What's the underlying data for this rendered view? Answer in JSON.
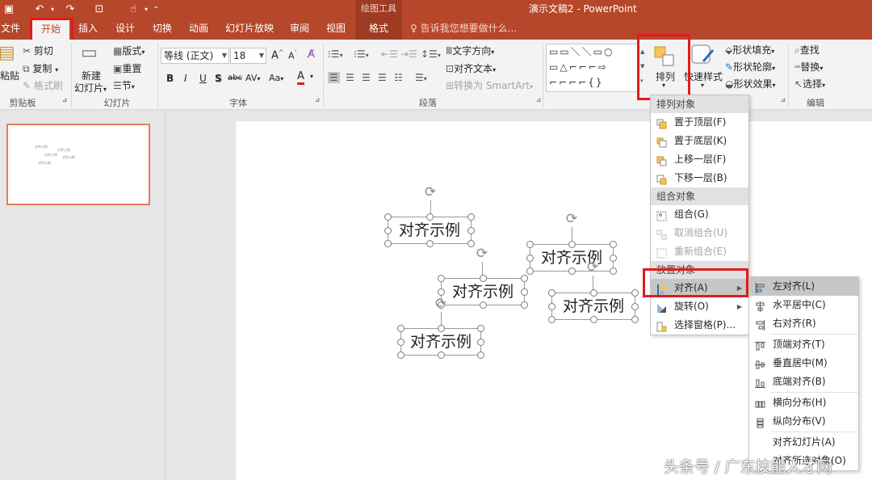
{
  "titlebar": {
    "context_title": "绘图工具",
    "doc_title": "演示文稿2 - PowerPoint"
  },
  "tabs": {
    "file": "文件",
    "home": "开始",
    "insert": "插入",
    "design": "设计",
    "transitions": "切换",
    "animations": "动画",
    "slideshow": "幻灯片放映",
    "review": "审阅",
    "view": "视图",
    "format": "格式",
    "tellme": "告诉我您想要做什么..."
  },
  "ribbon": {
    "clipboard": {
      "paste": "粘贴",
      "cut": "剪切",
      "copy": "复制",
      "format_painter": "格式刷",
      "label": "剪贴板"
    },
    "slides": {
      "new_slide_1": "新建",
      "new_slide_2": "幻灯片",
      "layout": "版式",
      "reset": "重置",
      "section": "节",
      "label": "幻灯片"
    },
    "font": {
      "font_name": "等线 (正文)",
      "font_size": "18",
      "grow": "A",
      "shrink": "A",
      "bold": "B",
      "italic": "I",
      "underline": "U",
      "shadow": "S",
      "strike": "abc",
      "spacing": "AV",
      "case": "Aa",
      "color": "A",
      "label": "字体"
    },
    "paragraph": {
      "text_direction": "文字方向",
      "align_text": "对齐文本",
      "smartart": "转换为 SmartArt",
      "label": "段落"
    },
    "drawing": {
      "shapes_glyphs": "▭▭＼＼▭○\n▭△⌐⌐⌐⇨\n⌐⌐⌐⌐{}",
      "arrange": "排列",
      "quick_styles": "快速样式",
      "shape_fill": "形状填充",
      "shape_outline": "形状轮廓",
      "shape_effects": "形状效果"
    },
    "editing": {
      "find": "查找",
      "replace": "替换",
      "select": "选择",
      "label": "编辑"
    }
  },
  "slide_boxes": [
    {
      "text": "对齐示例"
    },
    {
      "text": "对齐示例"
    },
    {
      "text": "对齐示例"
    },
    {
      "text": "对齐示例"
    },
    {
      "text": "对齐示例"
    }
  ],
  "arrange_menu": {
    "order_header": "排列对象",
    "bring_front": "置于顶层(F)",
    "send_back": "置于底层(K)",
    "bring_forward": "上移一层(F)",
    "send_backward": "下移一层(B)",
    "group_header": "组合对象",
    "group": "组合(G)",
    "ungroup": "取消组合(U)",
    "regroup": "重新组合(E)",
    "position_header": "放置对象",
    "align": "对齐(A)",
    "rotate": "旋转(O)",
    "selection_pane": "选择窗格(P)..."
  },
  "align_menu": {
    "left": "左对齐(L)",
    "center": "水平居中(C)",
    "right": "右对齐(R)",
    "top": "顶端对齐(T)",
    "middle": "垂直居中(M)",
    "bottom": "底端对齐(B)",
    "distribute_h": "横向分布(H)",
    "distribute_v": "纵向分布(V)",
    "to_slide": "对齐幻灯片(A)",
    "to_selected": "对齐所选对象(O)"
  },
  "watermark": "头条号 / 广东技能人才网",
  "colors": {
    "accent": "#b7472a",
    "highlight_red": "#e21b1b"
  }
}
